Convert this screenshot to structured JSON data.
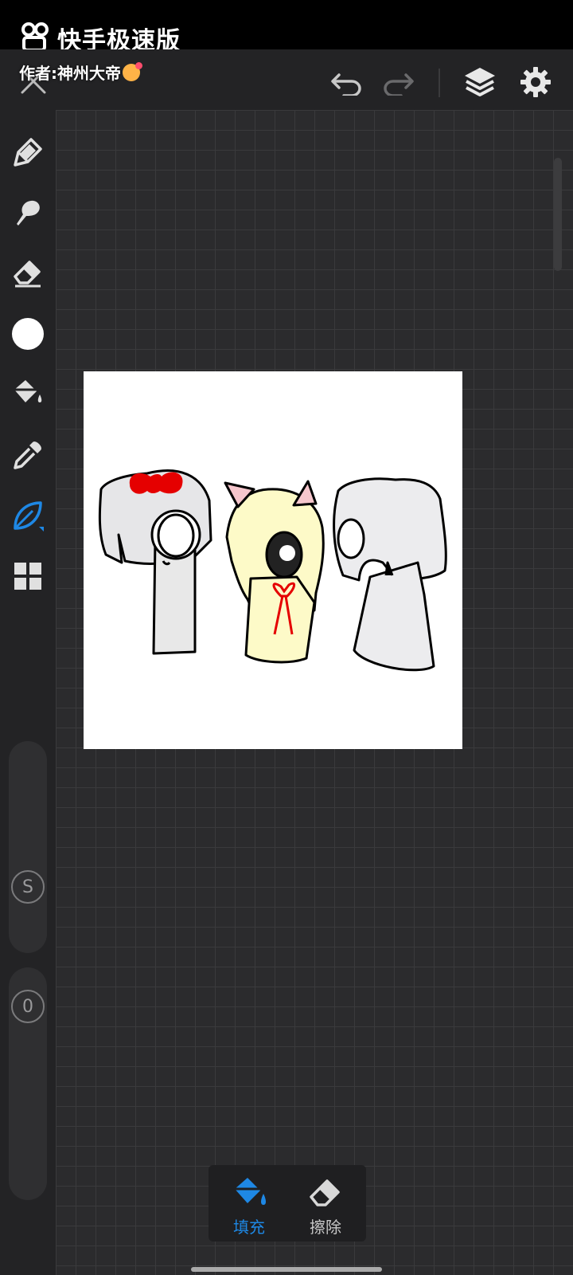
{
  "watermark": {
    "app_name": "快手极速版",
    "author": "作者:神州大帝",
    "logo_icon": "kuaishou-logo"
  },
  "toolbar": {
    "close_icon": "close-icon",
    "undo_icon": "undo-icon",
    "redo_icon": "redo-icon",
    "layers_icon": "layers-icon",
    "settings_icon": "gear-icon"
  },
  "sidebar": {
    "tools": [
      {
        "name": "pen",
        "icon": "pen-icon"
      },
      {
        "name": "smudge",
        "icon": "smudge-icon"
      },
      {
        "name": "eraser",
        "icon": "eraser-icon"
      },
      {
        "name": "color",
        "icon": "color-swatch",
        "color": "#ffffff"
      },
      {
        "name": "fill",
        "icon": "paint-bucket-icon"
      },
      {
        "name": "eyedropper",
        "icon": "eyedropper-icon"
      },
      {
        "name": "leaf",
        "icon": "leaf-icon",
        "active": true
      },
      {
        "name": "grid",
        "icon": "grid-icon"
      }
    ],
    "size_slider_label": "S",
    "opacity_slider_label": "0"
  },
  "bottom_panel": {
    "fill_label": "填充",
    "erase_label": "擦除"
  },
  "colors": {
    "accent": "#1e88e5",
    "background": "#2b2b2d",
    "panel": "#232325"
  }
}
